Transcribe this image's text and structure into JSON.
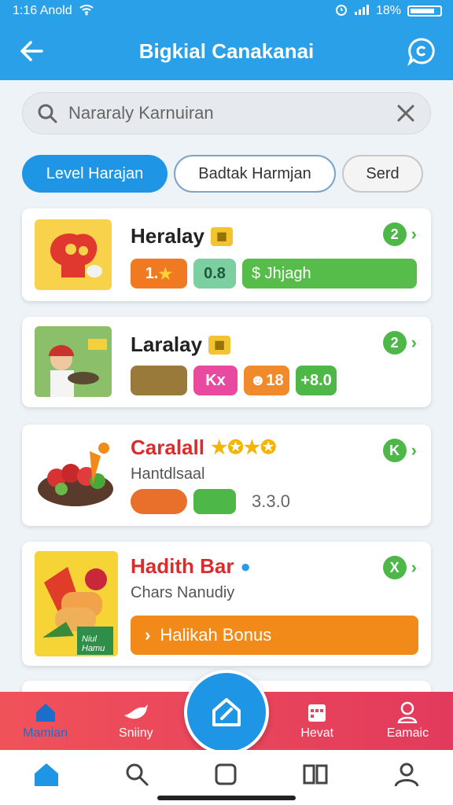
{
  "status_bar": {
    "time": "1:16 Anold",
    "battery": "18%"
  },
  "header": {
    "title": "Bigkial Canakanai"
  },
  "search": {
    "placeholder": "Nararaly Karnuiran"
  },
  "chips": [
    "Level Harajan",
    "Badtak Harmjan",
    "Serd"
  ],
  "cards": [
    {
      "title": "Heralay",
      "rank": "2",
      "badges": [
        "1.",
        "0.8",
        "$ Jhjagh"
      ]
    },
    {
      "title": "Laralay",
      "rank": "2",
      "badges": [
        "",
        "Kx",
        "18",
        "+8.0"
      ]
    },
    {
      "title": "Caralall",
      "subtitle": "Hantdlsaal",
      "rank": "K",
      "badges": [
        "",
        "",
        "3.3.0"
      ]
    },
    {
      "title": "Hadith Bar",
      "subtitle": "Chars Nanudiy",
      "rank": "X",
      "action": "Halikah Bonus",
      "thumb_label": "Niul Hamu"
    }
  ],
  "bottom_tabs": [
    {
      "label": "Mamian",
      "icon": "home-icon"
    },
    {
      "label": "Sniiny",
      "icon": "bird-icon"
    },
    {
      "label": "Hevat",
      "icon": "calendar-icon"
    },
    {
      "label": "Eamaic",
      "icon": "person-icon"
    }
  ],
  "nav": [
    "home-icon",
    "search-icon",
    "square-icon",
    "book-icon",
    "profile-icon"
  ],
  "colors": {
    "primary": "#2aa0e8",
    "accent_green": "#4db848",
    "accent_orange": "#f28a1a",
    "tab_red": "#e8445a"
  }
}
